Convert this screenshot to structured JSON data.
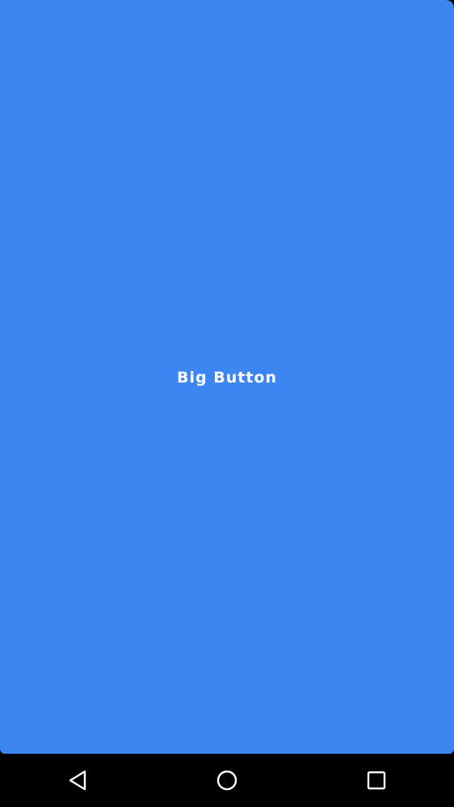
{
  "big_button": {
    "label": "Big Button",
    "color": "#3b86f0",
    "label_color": "#ffffff"
  },
  "nav_bar": {
    "background": "#000000",
    "icons": [
      "back-icon",
      "home-icon",
      "recents-icon"
    ]
  }
}
